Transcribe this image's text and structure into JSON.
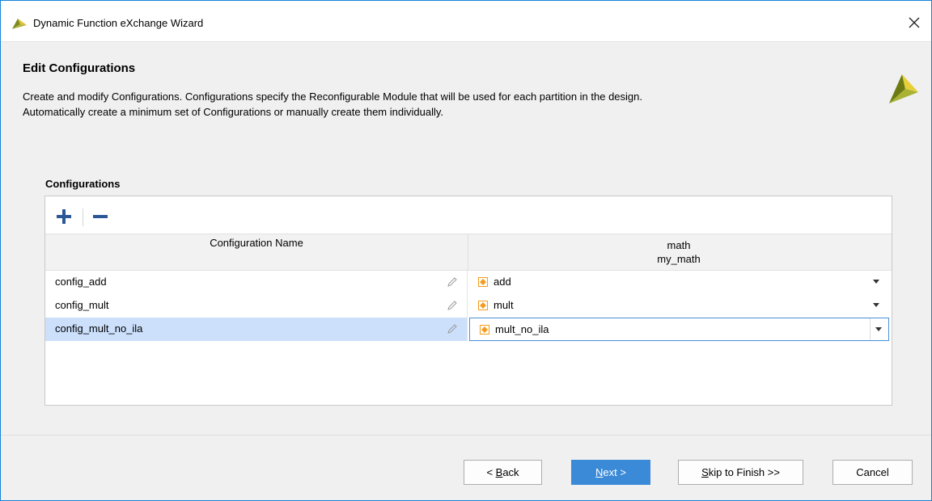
{
  "window": {
    "title": "Dynamic Function eXchange Wizard"
  },
  "header": {
    "title": "Edit Configurations",
    "description_line1": "Create and modify Configurations. Configurations specify the Reconfigurable Module that will be used for each partition in the design.",
    "description_line2": "Automatically create a minimum set of Configurations or manually create them individually."
  },
  "configurations": {
    "label": "Configurations",
    "columns": {
      "name": "Configuration Name",
      "partition_line1": "math",
      "partition_line2": "my_math"
    },
    "rows": [
      {
        "name": "config_add",
        "module": "add",
        "selected": false
      },
      {
        "name": "config_mult",
        "module": "mult",
        "selected": false
      },
      {
        "name": "config_mult_no_ila",
        "module": "mult_no_ila",
        "selected": true
      }
    ]
  },
  "footer": {
    "back_mnemonic": "B",
    "back_rest": "ack",
    "back_prefix": "< ",
    "next_mnemonic": "N",
    "next_rest": "ext >",
    "skip_mnemonic": "S",
    "skip_rest": "kip to Finish >>",
    "cancel": "Cancel"
  },
  "colors": {
    "accent": "#3b8ad8",
    "selection": "#cce0fc",
    "add_icon": "#2b5797",
    "module_icon": "#f39c1e"
  }
}
